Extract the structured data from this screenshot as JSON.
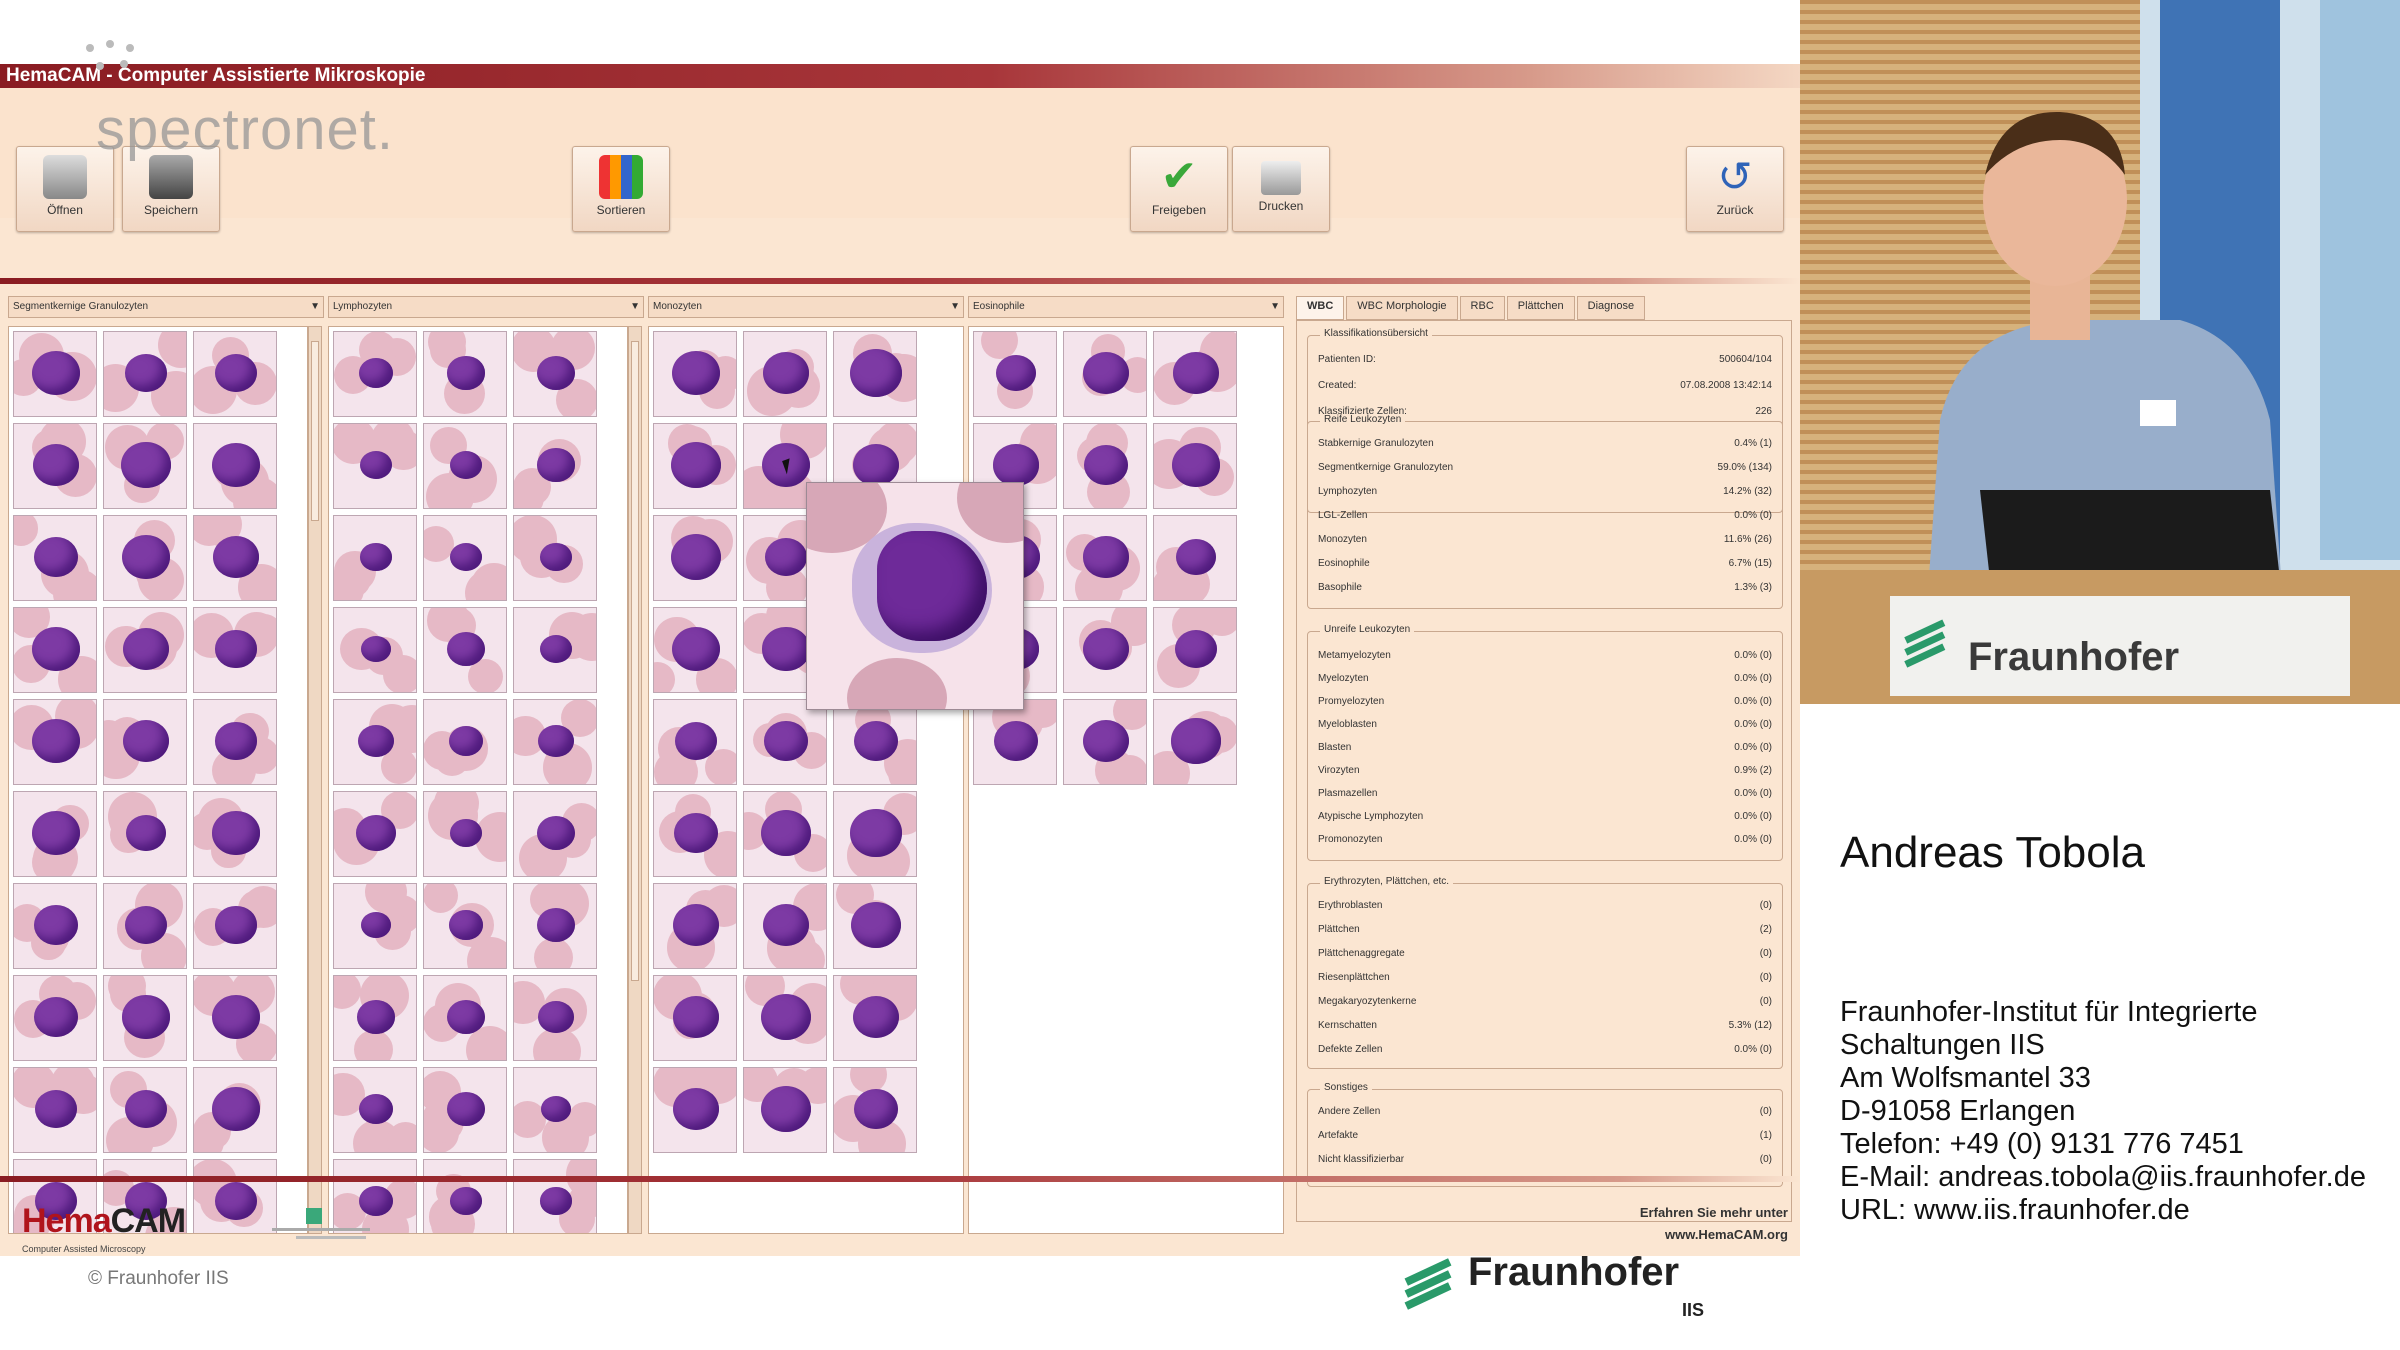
{
  "app": {
    "title": "HemaCAM - Computer Assistierte Mikroskopie",
    "toolbar": {
      "open": "Öffnen",
      "save": "Speichern",
      "sort": "Sortieren",
      "release": "Freigeben",
      "print": "Drucken",
      "back": "Zurück"
    },
    "columns": [
      {
        "header": "Segmentkernige Granulozyten"
      },
      {
        "header": "Lymphozyten"
      },
      {
        "header": "Monozyten"
      },
      {
        "header": "Eosinophile"
      }
    ],
    "tabs": [
      "WBC",
      "WBC Morphologie",
      "RBC",
      "Plättchen",
      "Diagnose"
    ],
    "panel": {
      "overview_title": "Klassifikationsübersicht",
      "patient_label": "Patienten ID:",
      "patient_value": "500604/104",
      "created_label": "Created:",
      "created_value": "07.08.2008 13:42:14",
      "classified_label": "Klassifizierte Zellen:",
      "classified_value": "226",
      "mature_title": "Reife Leukozyten",
      "mature": [
        {
          "k": "Stabkernige Granulozyten",
          "v": "0.4% (1)"
        },
        {
          "k": "Segmentkernige Granulozyten",
          "v": "59.0% (134)"
        },
        {
          "k": "Lymphozyten",
          "v": "14.2% (32)"
        },
        {
          "k": "LGL-Zellen",
          "v": "0.0% (0)"
        },
        {
          "k": "Monozyten",
          "v": "11.6% (26)"
        },
        {
          "k": "Eosinophile",
          "v": "6.7% (15)"
        },
        {
          "k": "Basophile",
          "v": "1.3% (3)"
        }
      ],
      "immature_title": "Unreife Leukozyten",
      "immature": [
        {
          "k": "Metamyelozyten",
          "v": "0.0% (0)"
        },
        {
          "k": "Myelozyten",
          "v": "0.0% (0)"
        },
        {
          "k": "Promyelozyten",
          "v": "0.0% (0)"
        },
        {
          "k": "Myeloblasten",
          "v": "0.0% (0)"
        },
        {
          "k": "Blasten",
          "v": "0.0% (0)"
        },
        {
          "k": "Virozyten",
          "v": "0.9% (2)"
        },
        {
          "k": "Plasmazellen",
          "v": "0.0% (0)"
        },
        {
          "k": "Atypische Lymphozyten",
          "v": "0.0% (0)"
        },
        {
          "k": "Promonozyten",
          "v": "0.0% (0)"
        }
      ],
      "ery_title": "Erythrozyten, Plättchen, etc.",
      "ery": [
        {
          "k": "Erythroblasten",
          "v": "(0)"
        },
        {
          "k": "Plättchen",
          "v": "(2)"
        },
        {
          "k": "Plättchenaggregate",
          "v": "(0)"
        },
        {
          "k": "Riesenplättchen",
          "v": "(0)"
        },
        {
          "k": "Megakaryozytenkerne",
          "v": "(0)"
        },
        {
          "k": "Kernschatten",
          "v": "5.3% (12)"
        },
        {
          "k": "Defekte Zellen",
          "v": "0.0% (0)"
        }
      ],
      "other_title": "Sonstiges",
      "other": [
        {
          "k": "Andere Zellen",
          "v": "(0)"
        },
        {
          "k": "Artefakte",
          "v": "(1)"
        },
        {
          "k": "Nicht klassifizierbar",
          "v": "(0)"
        }
      ]
    },
    "footer": {
      "logo_red": "Hema",
      "logo_dark": "CAM",
      "logo_sub": "Computer Assisted Microscopy",
      "learn_more_1": "Erfahren Sie mehr unter",
      "learn_more_2": "www.HemaCAM.org"
    }
  },
  "overlay": {
    "watermark": "spectronet.",
    "copyright": "© Fraunhofer IIS",
    "fraunhofer": "Fraunhofer",
    "iis": "IIS"
  },
  "speaker": {
    "podium": "Fraunhofer",
    "name": "Andreas Tobola",
    "contact": [
      "Fraunhofer-Institut für Integrierte",
      "Schaltungen IIS",
      "Am Wolfsmantel 33",
      "D-91058 Erlangen",
      "Telefon: +49 (0) 9131 776 7451",
      "E-Mail: andreas.tobola@iis.fraunhofer.de",
      "URL: www.iis.fraunhofer.de"
    ]
  }
}
